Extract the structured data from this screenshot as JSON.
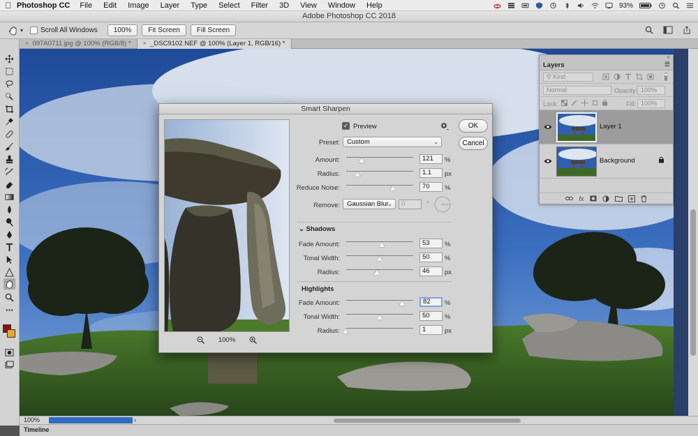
{
  "menubar": {
    "app": "Photoshop CC",
    "items": [
      "File",
      "Edit",
      "Image",
      "Layer",
      "Type",
      "Select",
      "Filter",
      "3D",
      "View",
      "Window",
      "Help"
    ],
    "battery": "93%"
  },
  "window": {
    "title": "Adobe Photoshop CC 2018"
  },
  "options": {
    "scroll_all": "Scroll All Windows",
    "zoom_100": "100%",
    "fit_screen": "Fit Screen",
    "fill_screen": "Fill Screen"
  },
  "tabs": [
    {
      "label": "097A0711.jpg @ 100% (RGB/8) *"
    },
    {
      "label": "_DSC9102.NEF @ 100% (Layer 1, RGB/16) *"
    }
  ],
  "status": {
    "zoom": "100%",
    "progress": 1.0
  },
  "timeline": {
    "label": "Timeline"
  },
  "layers_panel": {
    "title": "Layers",
    "kind": "Kind",
    "blend_mode": "Normal",
    "opacity_label": "Opacity:",
    "opacity_value": "100%",
    "lock_label": "Lock:",
    "fill_label": "Fill:",
    "fill_value": "100%",
    "layers": [
      {
        "name": "Layer 1",
        "selected": true
      },
      {
        "name": "Background",
        "locked": true
      }
    ]
  },
  "dialog": {
    "title": "Smart Sharpen",
    "preview_label": "Preview",
    "preview_checked": true,
    "preview_zoom": "100%",
    "ok": "OK",
    "cancel": "Cancel",
    "preset_label": "Preset:",
    "preset_value": "Custom",
    "amount_label": "Amount:",
    "amount_value": "121",
    "amount_unit": "%",
    "radius_label": "Radius:",
    "radius_value": "1.1",
    "radius_unit": "px",
    "noise_label": "Reduce Noise:",
    "noise_value": "70",
    "noise_unit": "%",
    "remove_label": "Remove:",
    "remove_value": "Gaussian Blur",
    "angle_value": "0",
    "angle_unit": "°",
    "shadows": {
      "title": "Shadows",
      "fade_label": "Fade Amount:",
      "fade_value": "53",
      "fade_unit": "%",
      "tonal_label": "Tonal Width:",
      "tonal_value": "50",
      "tonal_unit": "%",
      "radius_label": "Radius:",
      "radius_value": "46",
      "radius_unit": "px"
    },
    "highlights": {
      "title": "Highlights",
      "fade_label": "Fade Amount:",
      "fade_value": "82",
      "fade_unit": "%",
      "tonal_label": "Tonal Width:",
      "tonal_value": "50",
      "tonal_unit": "%",
      "radius_label": "Radius:",
      "radius_value": "1",
      "radius_unit": "px"
    }
  }
}
